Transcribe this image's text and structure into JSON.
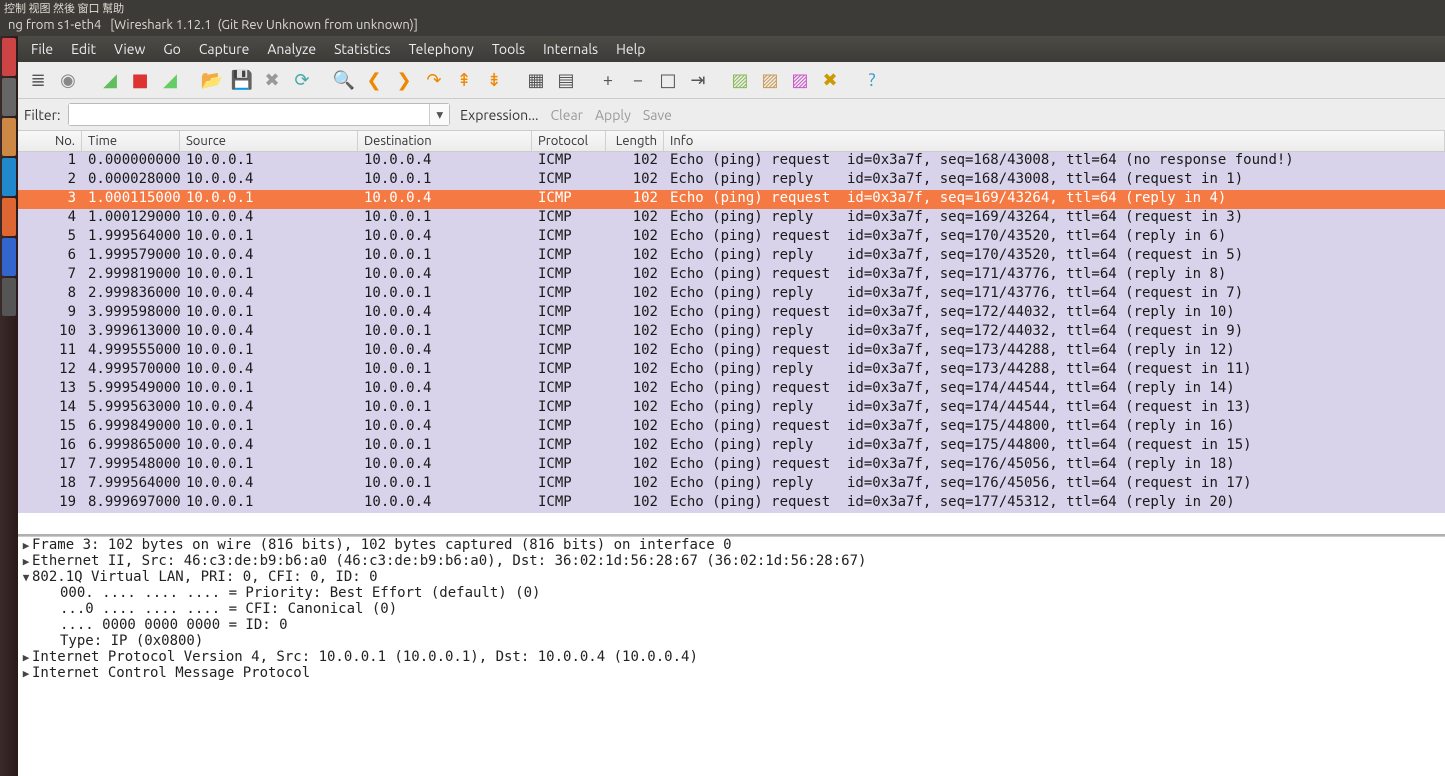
{
  "chinese_menu": "控制 视图 然後 窗口 幫助",
  "title_left": "ng from s1-eth4",
  "title_right": "[Wireshark 1.12.1  (Git Rev Unknown from unknown)]",
  "menubar": [
    "File",
    "Edit",
    "View",
    "Go",
    "Capture",
    "Analyze",
    "Statistics",
    "Telephony",
    "Tools",
    "Internals",
    "Help"
  ],
  "filter": {
    "label": "Filter:",
    "value": "",
    "expression": "Expression...",
    "clear": "Clear",
    "apply": "Apply",
    "save": "Save"
  },
  "columns": {
    "no": "No.",
    "time": "Time",
    "src": "Source",
    "dst": "Destination",
    "proto": "Protocol",
    "len": "Length",
    "info": "Info"
  },
  "packets": [
    {
      "no": 1,
      "time": "0.000000000",
      "src": "10.0.0.1",
      "dst": "10.0.0.4",
      "proto": "ICMP",
      "len": 102,
      "info": "Echo (ping) request  id=0x3a7f, seq=168/43008, ttl=64 (no response found!)",
      "sel": false
    },
    {
      "no": 2,
      "time": "0.000028000",
      "src": "10.0.0.4",
      "dst": "10.0.0.1",
      "proto": "ICMP",
      "len": 102,
      "info": "Echo (ping) reply    id=0x3a7f, seq=168/43008, ttl=64 (request in 1)",
      "sel": false
    },
    {
      "no": 3,
      "time": "1.000115000",
      "src": "10.0.0.1",
      "dst": "10.0.0.4",
      "proto": "ICMP",
      "len": 102,
      "info": "Echo (ping) request  id=0x3a7f, seq=169/43264, ttl=64 (reply in 4)",
      "sel": true
    },
    {
      "no": 4,
      "time": "1.000129000",
      "src": "10.0.0.4",
      "dst": "10.0.0.1",
      "proto": "ICMP",
      "len": 102,
      "info": "Echo (ping) reply    id=0x3a7f, seq=169/43264, ttl=64 (request in 3)",
      "sel": false
    },
    {
      "no": 5,
      "time": "1.999564000",
      "src": "10.0.0.1",
      "dst": "10.0.0.4",
      "proto": "ICMP",
      "len": 102,
      "info": "Echo (ping) request  id=0x3a7f, seq=170/43520, ttl=64 (reply in 6)",
      "sel": false
    },
    {
      "no": 6,
      "time": "1.999579000",
      "src": "10.0.0.4",
      "dst": "10.0.0.1",
      "proto": "ICMP",
      "len": 102,
      "info": "Echo (ping) reply    id=0x3a7f, seq=170/43520, ttl=64 (request in 5)",
      "sel": false
    },
    {
      "no": 7,
      "time": "2.999819000",
      "src": "10.0.0.1",
      "dst": "10.0.0.4",
      "proto": "ICMP",
      "len": 102,
      "info": "Echo (ping) request  id=0x3a7f, seq=171/43776, ttl=64 (reply in 8)",
      "sel": false
    },
    {
      "no": 8,
      "time": "2.999836000",
      "src": "10.0.0.4",
      "dst": "10.0.0.1",
      "proto": "ICMP",
      "len": 102,
      "info": "Echo (ping) reply    id=0x3a7f, seq=171/43776, ttl=64 (request in 7)",
      "sel": false
    },
    {
      "no": 9,
      "time": "3.999598000",
      "src": "10.0.0.1",
      "dst": "10.0.0.4",
      "proto": "ICMP",
      "len": 102,
      "info": "Echo (ping) request  id=0x3a7f, seq=172/44032, ttl=64 (reply in 10)",
      "sel": false
    },
    {
      "no": 10,
      "time": "3.999613000",
      "src": "10.0.0.4",
      "dst": "10.0.0.1",
      "proto": "ICMP",
      "len": 102,
      "info": "Echo (ping) reply    id=0x3a7f, seq=172/44032, ttl=64 (request in 9)",
      "sel": false
    },
    {
      "no": 11,
      "time": "4.999555000",
      "src": "10.0.0.1",
      "dst": "10.0.0.4",
      "proto": "ICMP",
      "len": 102,
      "info": "Echo (ping) request  id=0x3a7f, seq=173/44288, ttl=64 (reply in 12)",
      "sel": false
    },
    {
      "no": 12,
      "time": "4.999570000",
      "src": "10.0.0.4",
      "dst": "10.0.0.1",
      "proto": "ICMP",
      "len": 102,
      "info": "Echo (ping) reply    id=0x3a7f, seq=173/44288, ttl=64 (request in 11)",
      "sel": false
    },
    {
      "no": 13,
      "time": "5.999549000",
      "src": "10.0.0.1",
      "dst": "10.0.0.4",
      "proto": "ICMP",
      "len": 102,
      "info": "Echo (ping) request  id=0x3a7f, seq=174/44544, ttl=64 (reply in 14)",
      "sel": false
    },
    {
      "no": 14,
      "time": "5.999563000",
      "src": "10.0.0.4",
      "dst": "10.0.0.1",
      "proto": "ICMP",
      "len": 102,
      "info": "Echo (ping) reply    id=0x3a7f, seq=174/44544, ttl=64 (request in 13)",
      "sel": false
    },
    {
      "no": 15,
      "time": "6.999849000",
      "src": "10.0.0.1",
      "dst": "10.0.0.4",
      "proto": "ICMP",
      "len": 102,
      "info": "Echo (ping) request  id=0x3a7f, seq=175/44800, ttl=64 (reply in 16)",
      "sel": false
    },
    {
      "no": 16,
      "time": "6.999865000",
      "src": "10.0.0.4",
      "dst": "10.0.0.1",
      "proto": "ICMP",
      "len": 102,
      "info": "Echo (ping) reply    id=0x3a7f, seq=175/44800, ttl=64 (request in 15)",
      "sel": false
    },
    {
      "no": 17,
      "time": "7.999548000",
      "src": "10.0.0.1",
      "dst": "10.0.0.4",
      "proto": "ICMP",
      "len": 102,
      "info": "Echo (ping) request  id=0x3a7f, seq=176/45056, ttl=64 (reply in 18)",
      "sel": false
    },
    {
      "no": 18,
      "time": "7.999564000",
      "src": "10.0.0.4",
      "dst": "10.0.0.1",
      "proto": "ICMP",
      "len": 102,
      "info": "Echo (ping) reply    id=0x3a7f, seq=176/45056, ttl=64 (request in 17)",
      "sel": false
    },
    {
      "no": 19,
      "time": "8.999697000",
      "src": "10.0.0.1",
      "dst": "10.0.0.4",
      "proto": "ICMP",
      "len": 102,
      "info": "Echo (ping) request  id=0x3a7f, seq=177/45312, ttl=64 (reply in 20)",
      "sel": false
    }
  ],
  "details": [
    {
      "expand": "collapsed",
      "text": "Frame 3: 102 bytes on wire (816 bits), 102 bytes captured (816 bits) on interface 0"
    },
    {
      "expand": "collapsed",
      "text": "Ethernet II, Src: 46:c3:de:b9:b6:a0 (46:c3:de:b9:b6:a0), Dst: 36:02:1d:56:28:67 (36:02:1d:56:28:67)"
    },
    {
      "expand": "expanded",
      "text": "802.1Q Virtual LAN, PRI: 0, CFI: 0, ID: 0"
    },
    {
      "expand": "child",
      "text": "000. .... .... .... = Priority: Best Effort (default) (0)"
    },
    {
      "expand": "child",
      "text": "...0 .... .... .... = CFI: Canonical (0)"
    },
    {
      "expand": "child",
      "text": ".... 0000 0000 0000 = ID: 0"
    },
    {
      "expand": "child",
      "text": "Type: IP (0x0800)"
    },
    {
      "expand": "collapsed",
      "text": "Internet Protocol Version 4, Src: 10.0.0.1 (10.0.0.1), Dst: 10.0.0.4 (10.0.0.4)"
    },
    {
      "expand": "collapsed",
      "text": "Internet Control Message Protocol"
    }
  ],
  "toolbar_icons": [
    {
      "name": "list-icon",
      "glyph": "≣",
      "color": "#555"
    },
    {
      "name": "options-icon",
      "glyph": "◉",
      "color": "#888"
    },
    {
      "name": "sep"
    },
    {
      "name": "start-capture-icon",
      "glyph": "◢",
      "color": "#5fbf5f"
    },
    {
      "name": "stop-capture-icon",
      "glyph": "■",
      "color": "#d33"
    },
    {
      "name": "restart-capture-icon",
      "glyph": "◢",
      "color": "#6c6"
    },
    {
      "name": "sep"
    },
    {
      "name": "open-icon",
      "glyph": "📂",
      "color": "#c9a36b"
    },
    {
      "name": "save-icon",
      "glyph": "💾",
      "color": "#aaa"
    },
    {
      "name": "close-icon",
      "glyph": "✖",
      "color": "#999"
    },
    {
      "name": "reload-icon",
      "glyph": "⟳",
      "color": "#4aa"
    },
    {
      "name": "sep"
    },
    {
      "name": "find-icon",
      "glyph": "🔍",
      "color": "#36c"
    },
    {
      "name": "back-icon",
      "glyph": "❮",
      "color": "#e80"
    },
    {
      "name": "fwd-icon",
      "glyph": "❯",
      "color": "#e80"
    },
    {
      "name": "jump-icon",
      "glyph": "↷",
      "color": "#e80"
    },
    {
      "name": "goto-first-icon",
      "glyph": "⇞",
      "color": "#e80"
    },
    {
      "name": "goto-last-icon",
      "glyph": "⇟",
      "color": "#e80"
    },
    {
      "name": "sep"
    },
    {
      "name": "colorize-icon",
      "glyph": "▦",
      "color": "#555"
    },
    {
      "name": "auto-scroll-icon",
      "glyph": "▤",
      "color": "#555"
    },
    {
      "name": "sep"
    },
    {
      "name": "zoom-in-icon",
      "glyph": "+",
      "color": "#555"
    },
    {
      "name": "zoom-out-icon",
      "glyph": "−",
      "color": "#555"
    },
    {
      "name": "zoom-reset-icon",
      "glyph": "□",
      "color": "#555"
    },
    {
      "name": "resize-cols-icon",
      "glyph": "⇥",
      "color": "#555"
    },
    {
      "name": "sep"
    },
    {
      "name": "capture-filters-icon",
      "glyph": "▨",
      "color": "#8b5"
    },
    {
      "name": "display-filters-icon",
      "glyph": "▨",
      "color": "#c95"
    },
    {
      "name": "coloring-rules-icon",
      "glyph": "▨",
      "color": "#c5c"
    },
    {
      "name": "prefs-icon",
      "glyph": "✖",
      "color": "#c90"
    },
    {
      "name": "sep"
    },
    {
      "name": "help-icon",
      "glyph": "?",
      "color": "#39c"
    }
  ]
}
